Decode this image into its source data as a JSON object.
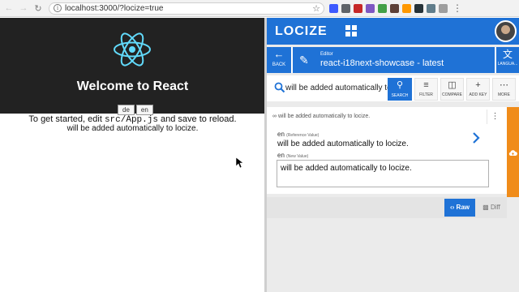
{
  "browser": {
    "url": "localhost:3000/?locize=true",
    "back_icon": "arrow-left",
    "forward_icon": "arrow-right",
    "reload_icon": "reload",
    "info_icon": "info",
    "star_icon": "star",
    "extension_colors": [
      "#3d5afe",
      "#5f6368",
      "#c62828",
      "#7e57c2",
      "#43a047",
      "#5d4037",
      "#ff9800",
      "#263238",
      "#607d8b",
      "#9e9e9e"
    ]
  },
  "react_app": {
    "title": "Welcome to React",
    "lang_buttons": [
      "de",
      "en"
    ],
    "intro_prefix": "To get started, edit ",
    "intro_code": "src/App.js",
    "intro_suffix": " and save to reload.",
    "translated_line": "will be added automatically to locize.",
    "logo_color": "#61dafb",
    "header_color": "#222222"
  },
  "locize": {
    "logo": "LOCIZE",
    "accent": "#1f72d6",
    "orange": "#f08c1a",
    "editor": {
      "back_label": "BACK",
      "small_label": "Editor",
      "title": "react-i18next-showcase - latest",
      "language_label": "LANGUA..."
    },
    "toolbar": {
      "search_value": "will be added automatically to",
      "search_label": "SEARCH",
      "filter_label": "FILTER",
      "compare_label": "COMPARE",
      "add_key_label": "ADD KEY",
      "more_label": "MORE"
    },
    "card": {
      "key_prefix": "∞",
      "key": "will be added automatically to locize.",
      "ref_lang": "en",
      "ref_tag": "(Reference Value)",
      "ref_value": "will be added automatically to locize.",
      "new_lang": "en",
      "new_tag": "(New Value)",
      "new_value": "will be added automatically to locize.",
      "raw_label": "Raw",
      "raw_glyph": "‹›",
      "diff_label": "Diff"
    }
  }
}
